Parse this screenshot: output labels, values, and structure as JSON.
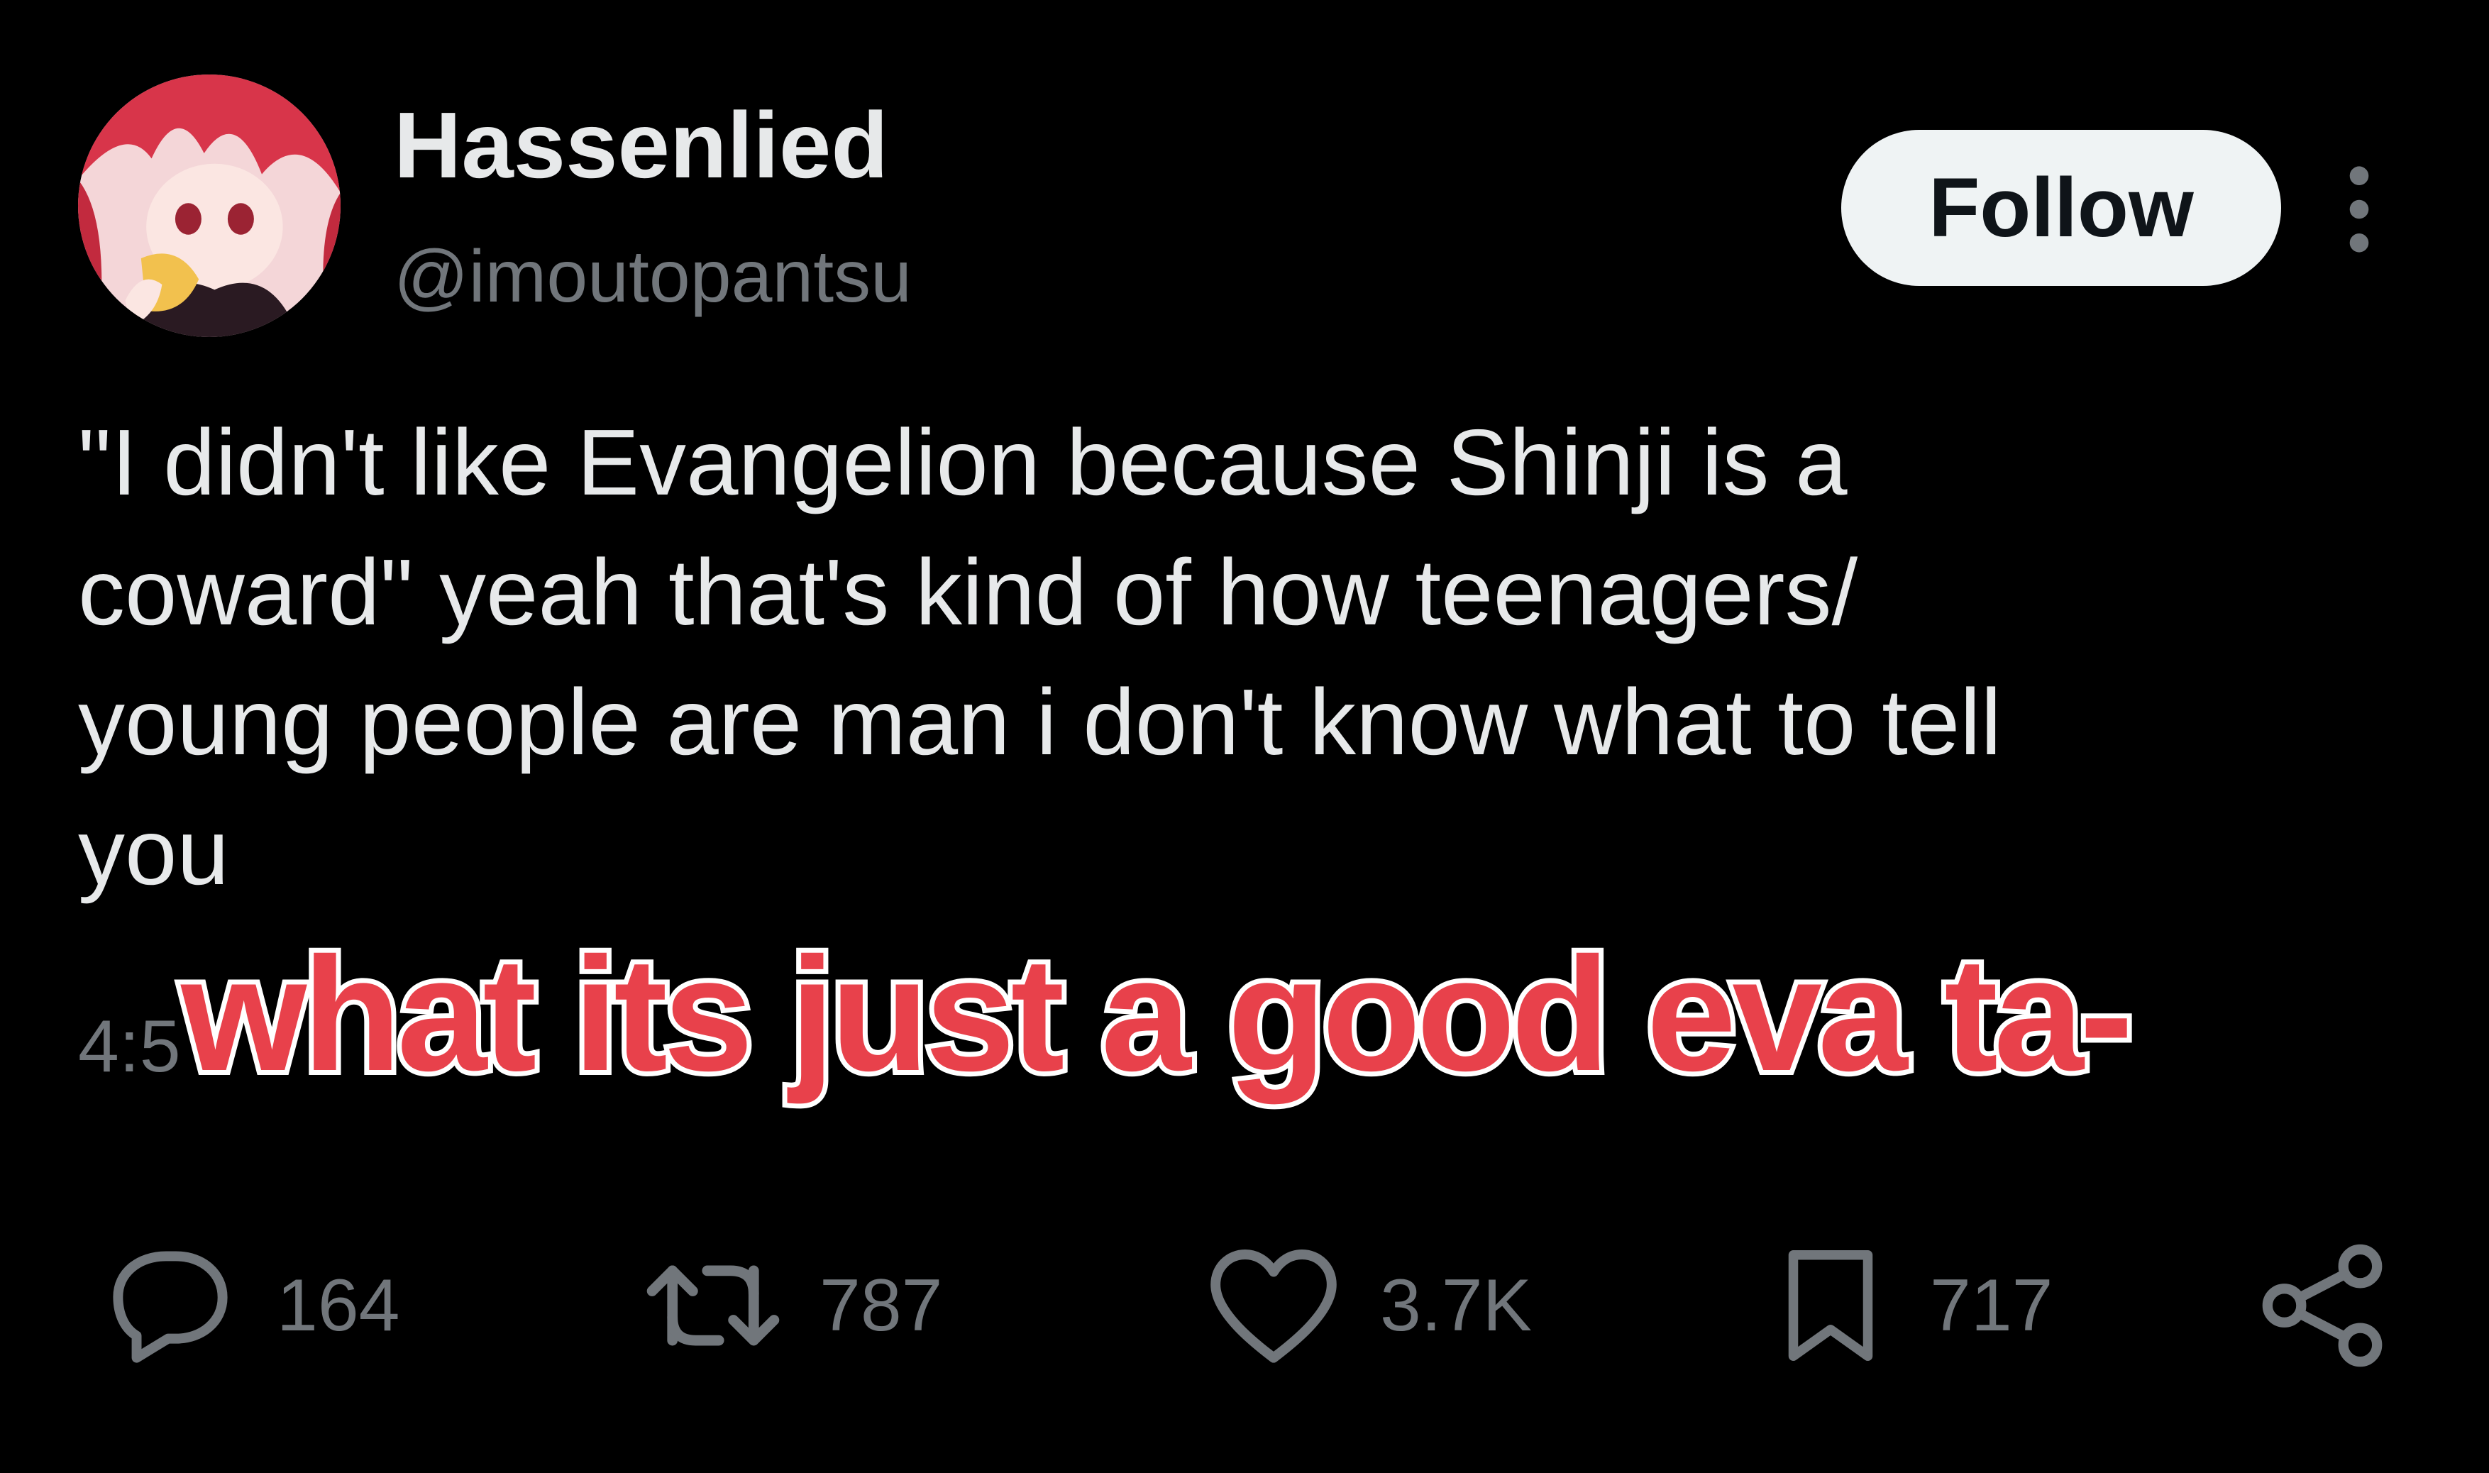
{
  "colors": {
    "background": "#000000",
    "primary_text": "#e7e9ea",
    "secondary_text": "#71767b",
    "follow_bg": "#eff3f4",
    "caption_red": "#e8414b",
    "caption_outline": "#ffffff"
  },
  "author": {
    "display_name": "Hassenlied",
    "handle": "@imoutopantsu",
    "avatar_icon": "avatar-icon"
  },
  "header": {
    "follow_label": "Follow",
    "more_icon": "more-vertical-icon"
  },
  "tweet": {
    "lines": [
      "\"I didn't like Evangelion because Shinji is a",
      "coward\" yeah that's kind of how teenagers/",
      "young people are man i don't know what to tell",
      "you"
    ],
    "timestamp": "4:5"
  },
  "overlay": {
    "caption": "what its just a good eva ta-"
  },
  "actions": {
    "reply": {
      "icon": "reply-icon",
      "count": "164"
    },
    "retweet": {
      "icon": "retweet-icon",
      "count": "787"
    },
    "like": {
      "icon": "heart-icon",
      "count": "3.7K"
    },
    "bookmark": {
      "icon": "bookmark-icon",
      "count": "717"
    },
    "share": {
      "icon": "share-icon"
    }
  }
}
